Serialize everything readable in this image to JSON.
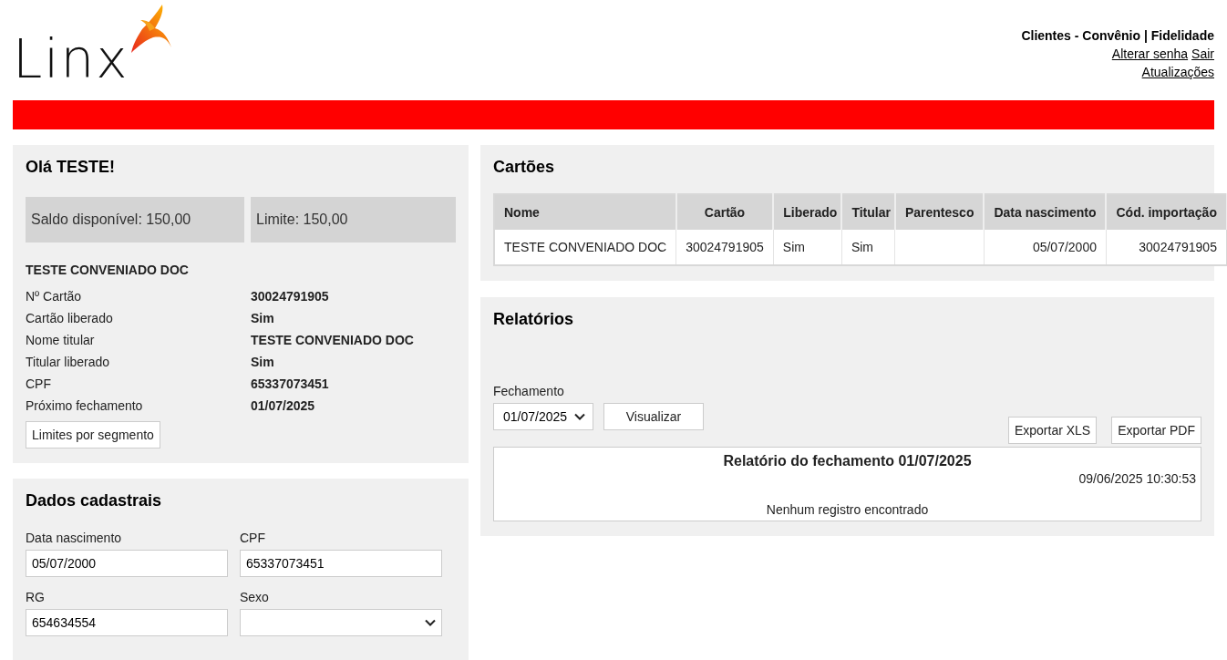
{
  "header": {
    "logo_text": "Linx",
    "nav_title": "Clientes - Convênio | Fidelidade",
    "links": [
      "Alterar senha",
      "Sair"
    ],
    "links_2": [
      "Atualizações"
    ]
  },
  "welcome": {
    "title": "Olá TESTE!",
    "balances": [
      "Saldo disponível: 150,00",
      "Limite: 150,00"
    ],
    "holder_name": "TESTE CONVENIADO DOC",
    "details": [
      {
        "label": "Nº Cartão",
        "value": "30024791905"
      },
      {
        "label": "Cartão liberado",
        "value": "Sim"
      },
      {
        "label": "Nome titular",
        "value": "TESTE CONVENIADO DOC"
      },
      {
        "label": "Titular liberado",
        "value": "Sim"
      },
      {
        "label": "CPF",
        "value": "65337073451"
      },
      {
        "label": "Próximo fechamento",
        "value": "01/07/2025"
      }
    ],
    "button": "Limites por segmento"
  },
  "registration": {
    "title": "Dados cadastrais",
    "fields": [
      {
        "label": "Data nascimento",
        "value": "05/07/2000",
        "kind": "text"
      },
      {
        "label": "CPF",
        "value": "65337073451",
        "kind": "text"
      },
      {
        "label": "RG",
        "value": "654634554",
        "kind": "text"
      },
      {
        "label": "Sexo",
        "kind": "select"
      }
    ]
  },
  "cards": {
    "title": "Cartões",
    "table": {
      "columns": [
        "Nome",
        "Cartão",
        "Liberado",
        "Titular",
        "Parentesco",
        "Data nascimento",
        "Cód. importação"
      ],
      "rows": [
        [
          "TESTE CONVENIADO DOC",
          "30024791905",
          "Sim",
          "Sim",
          "",
          "05/07/2000",
          "30024791905"
        ]
      ]
    }
  },
  "reports": {
    "title": "Relatórios",
    "filter_label": "Fechamento",
    "filter_value": "01/07/2025",
    "view_button": "Visualizar",
    "export_buttons": [
      "Exportar XLS",
      "Exportar PDF"
    ],
    "report": {
      "title": "Relatório do fechamento 01/07/2025",
      "timestamp": "09/06/2025 10:30:53",
      "empty_message": "Nenhum registro encontrado"
    }
  }
}
